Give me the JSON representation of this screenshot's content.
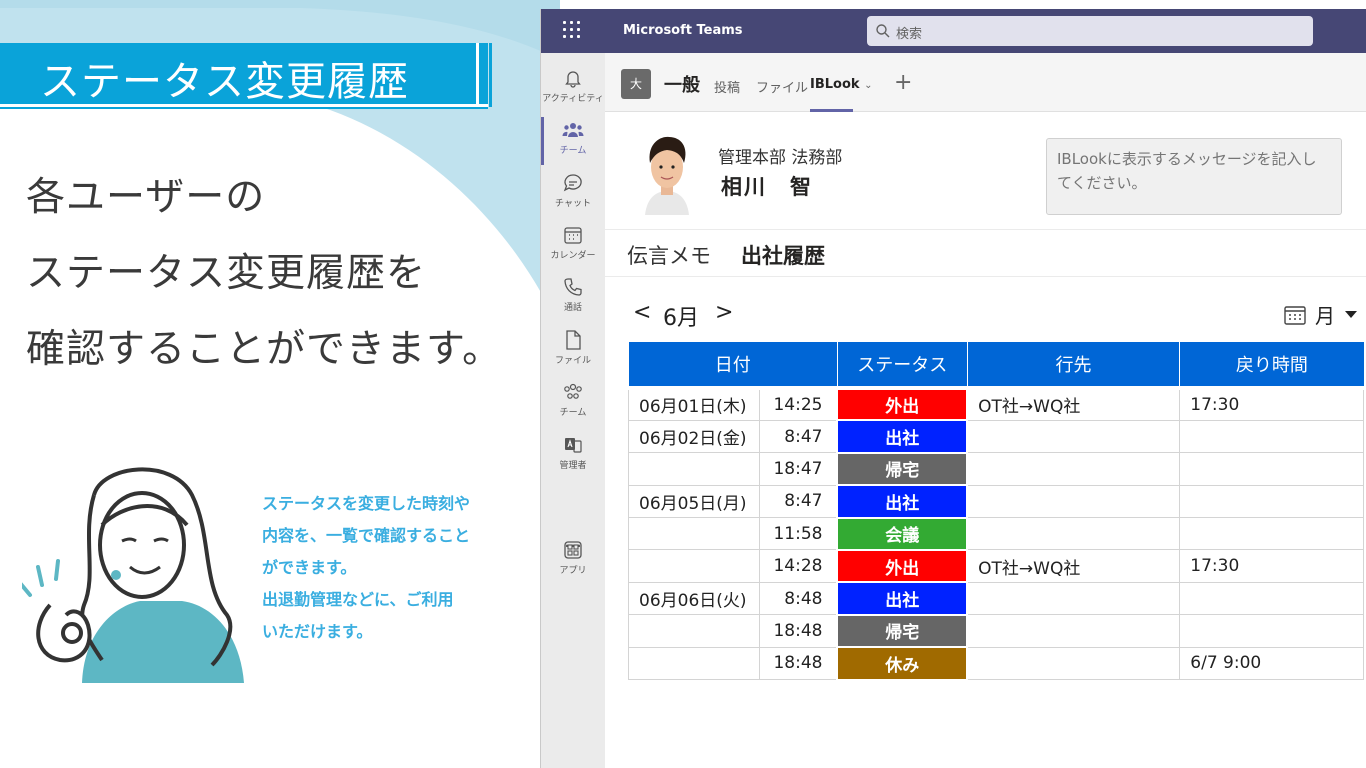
{
  "promo": {
    "title": "ステータス変更履歴",
    "lead": [
      "各ユーザーの",
      "ステータス変更履歴を",
      "確認することができます。"
    ],
    "note": [
      "ステータスを変更した時刻や",
      "内容を、一覧で確認すること",
      "ができます。",
      "出退勤管理などに、ご利用",
      "いただけます。"
    ]
  },
  "app": {
    "title": "Microsoft Teams",
    "search_placeholder": "検索"
  },
  "rail": [
    {
      "label": "アクティビティ",
      "icon": "bell-icon"
    },
    {
      "label": "チーム",
      "icon": "teams-icon"
    },
    {
      "label": "チャット",
      "icon": "chat-icon"
    },
    {
      "label": "カレンダー",
      "icon": "calendar-icon"
    },
    {
      "label": "通話",
      "icon": "phone-icon"
    },
    {
      "label": "ファイル",
      "icon": "file-icon"
    },
    {
      "label": "チーム",
      "icon": "people-icon"
    },
    {
      "label": "管理者",
      "icon": "admin-icon"
    },
    {
      "label": "アプリ",
      "icon": "apps-icon"
    }
  ],
  "rail_more": "…",
  "channel": {
    "avatar": "大",
    "name": "一般",
    "tabs": [
      "投稿",
      "ファイル",
      "IBLook"
    ],
    "active_tab": "IBLook",
    "add": "+"
  },
  "profile": {
    "department": "管理本部 法務部",
    "name": "相川　智",
    "message_placeholder": "IBLookに表示するメッセージを記入してください。"
  },
  "subtabs": [
    "伝言メモ",
    "出社履歴"
  ],
  "calendar": {
    "prev": "<",
    "month": "6月",
    "next": ">",
    "view": "月"
  },
  "colors": {
    "外出": "#ff0000",
    "出社": "#0022ff",
    "帰宅": "#666666",
    "会議": "#33aa33",
    "休み": "#a06a00"
  },
  "table": {
    "headers": [
      "日付",
      "ステータス",
      "行先",
      "戻り時間"
    ],
    "rows": [
      {
        "date": "06月01日(木)",
        "time": "14:25",
        "status": "外出",
        "dest": "OT社→WQ社",
        "back": "17:30"
      },
      {
        "date": "06月02日(金)",
        "time": "8:47",
        "status": "出社",
        "dest": "",
        "back": ""
      },
      {
        "date": "",
        "time": "18:47",
        "status": "帰宅",
        "dest": "",
        "back": ""
      },
      {
        "date": "06月05日(月)",
        "time": "8:47",
        "status": "出社",
        "dest": "",
        "back": ""
      },
      {
        "date": "",
        "time": "11:58",
        "status": "会議",
        "dest": "",
        "back": ""
      },
      {
        "date": "",
        "time": "14:28",
        "status": "外出",
        "dest": "OT社→WQ社",
        "back": "17:30"
      },
      {
        "date": "06月06日(火)",
        "time": "8:48",
        "status": "出社",
        "dest": "",
        "back": ""
      },
      {
        "date": "",
        "time": "18:48",
        "status": "帰宅",
        "dest": "",
        "back": ""
      },
      {
        "date": "",
        "time": "18:48",
        "status": "休み",
        "dest": "",
        "back": "6/7 9:00"
      }
    ]
  }
}
